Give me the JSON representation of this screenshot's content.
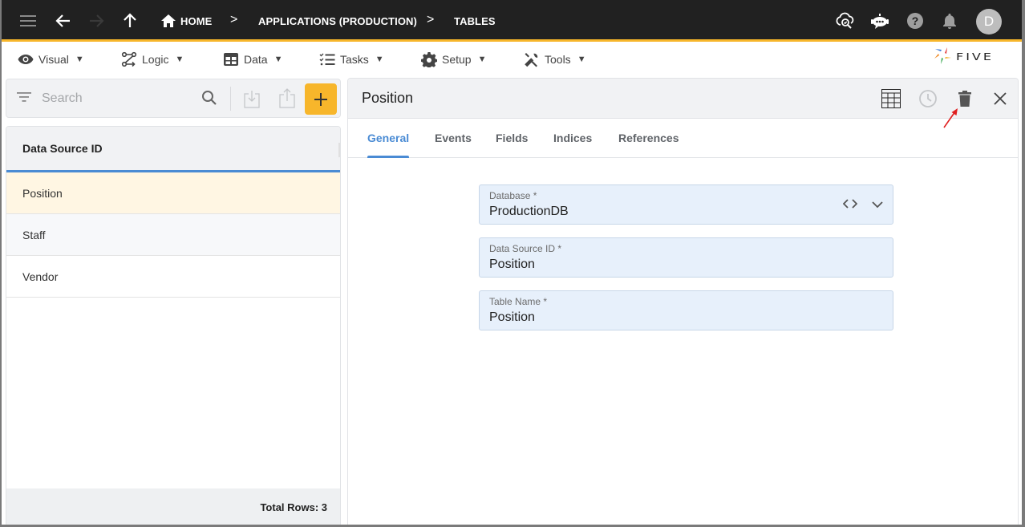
{
  "appbar": {
    "icons": {
      "menu": "hamburger-menu-icon",
      "back": "arrow-left-icon",
      "forward": "arrow-right-icon",
      "up": "arrow-up-icon",
      "home": "home-icon",
      "cloud_search": "cloud-search-icon",
      "chat_bot": "chat-bot-icon",
      "help": "help-icon",
      "notifications": "bell-icon"
    },
    "breadcrumbs": [
      {
        "label": "HOME"
      },
      {
        "label": "APPLICATIONS (PRODUCTION)"
      },
      {
        "label": "TABLES"
      }
    ],
    "separator": ">",
    "avatar_initial": "D",
    "accent_color": "#f7b62b"
  },
  "menubar": {
    "items": [
      {
        "label": "Visual",
        "icon": "eye-icon"
      },
      {
        "label": "Logic",
        "icon": "logic-flow-icon"
      },
      {
        "label": "Data",
        "icon": "table-grid-icon"
      },
      {
        "label": "Tasks",
        "icon": "checklist-icon"
      },
      {
        "label": "Setup",
        "icon": "gear-icon"
      },
      {
        "label": "Tools",
        "icon": "tools-icon"
      }
    ],
    "caret": "▼",
    "logo_text": "FIVE"
  },
  "list": {
    "search_placeholder": "Search",
    "column_header": "Data Source ID",
    "rows": [
      {
        "label": "Position",
        "selected": true
      },
      {
        "label": "Staff",
        "selected": false
      },
      {
        "label": "Vendor",
        "selected": false
      }
    ],
    "footer": "Total Rows: 3"
  },
  "detail": {
    "title": "Position",
    "tabs": [
      {
        "label": "General",
        "active": true
      },
      {
        "label": "Events",
        "active": false
      },
      {
        "label": "Fields",
        "active": false
      },
      {
        "label": "Indices",
        "active": false
      },
      {
        "label": "References",
        "active": false
      }
    ],
    "fields": [
      {
        "label": "Database *",
        "value": "ProductionDB",
        "type": "select"
      },
      {
        "label": "Data Source ID *",
        "value": "Position",
        "type": "text"
      },
      {
        "label": "Table Name *",
        "value": "Position",
        "type": "text"
      }
    ]
  }
}
